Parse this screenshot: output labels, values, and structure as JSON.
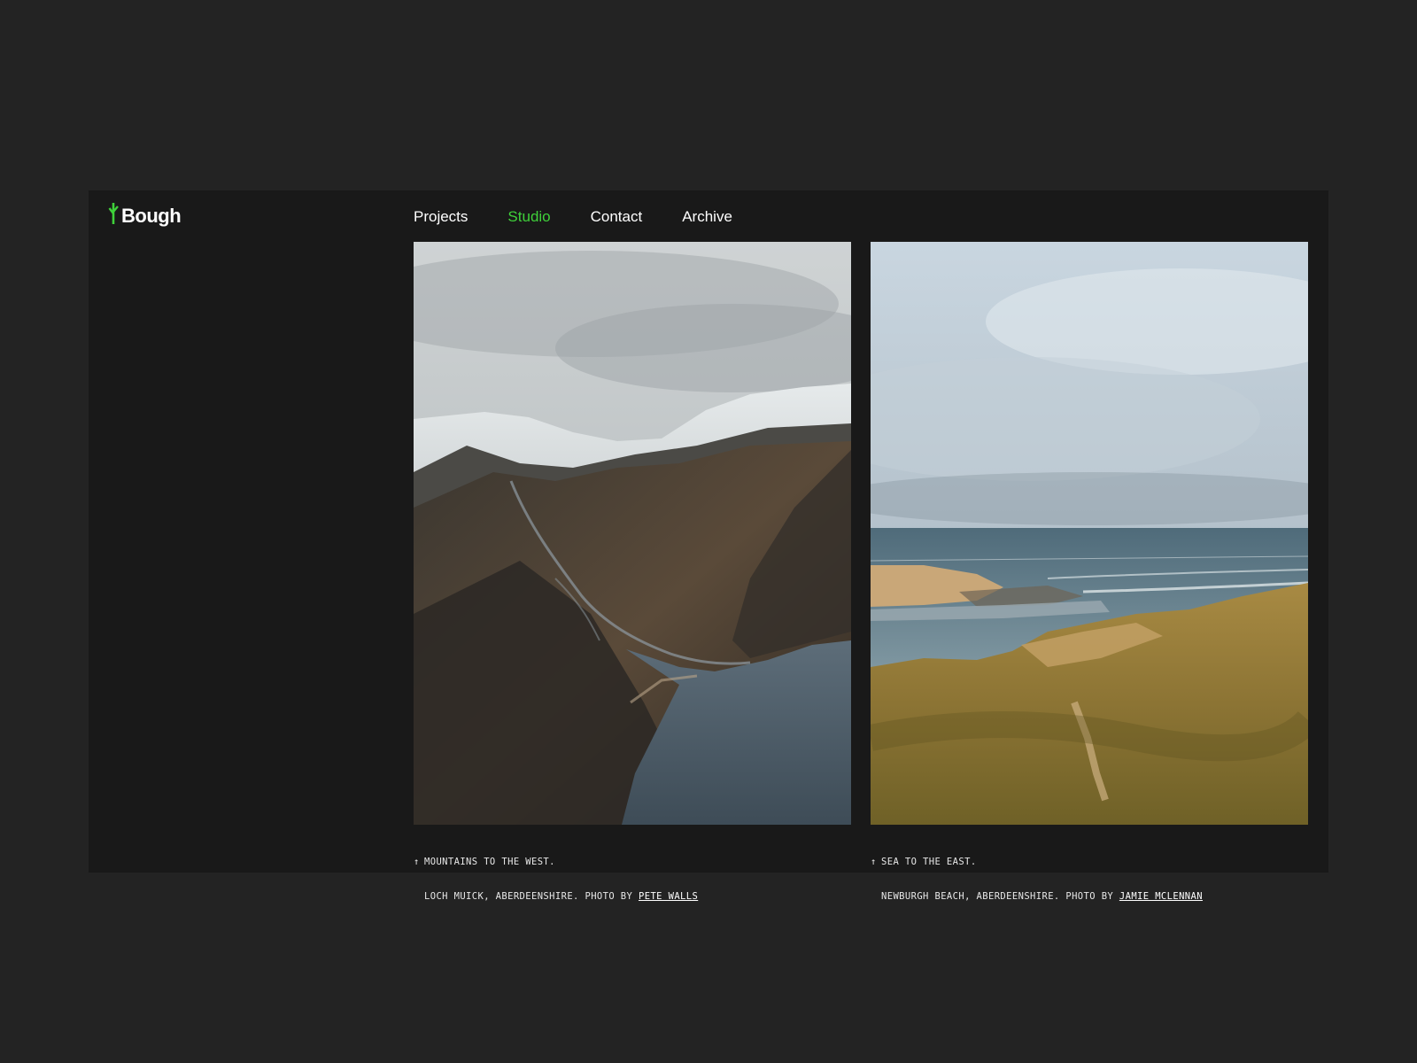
{
  "brand": {
    "name": "Bough",
    "accent_color": "#3fd13a",
    "logo_icon": "sprout-icon"
  },
  "nav": {
    "items": [
      {
        "label": "Projects",
        "active": false
      },
      {
        "label": "Studio",
        "active": true
      },
      {
        "label": "Contact",
        "active": false
      },
      {
        "label": "Archive",
        "active": false
      }
    ]
  },
  "gallery": [
    {
      "image": "mountain-valley-loch",
      "arrow": "↑",
      "title": "MOUNTAINS TO THE WEST.",
      "location": "LOCH MUICK, ABERDEENSHIRE. PHOTO BY",
      "credit": "PETE WALLS"
    },
    {
      "image": "beach-dunes-sea",
      "arrow": "↑",
      "title": "SEA TO THE EAST.",
      "location": "NEWBURGH BEACH, ABERDEENSHIRE. PHOTO BY",
      "credit": "JAMIE MCLENNAN"
    }
  ]
}
